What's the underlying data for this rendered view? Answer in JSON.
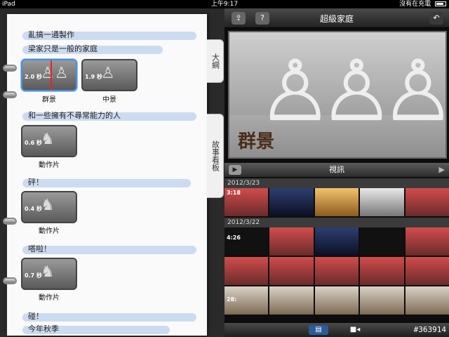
{
  "status": {
    "device": "iPad",
    "time": "上午9:17",
    "charging": "沒有在充電"
  },
  "notebook": {
    "tabs": [
      "大綱",
      "故事看板"
    ],
    "sections": [
      {
        "text": "亂搞一通製作"
      },
      {
        "text": "梁家只是一般的家庭"
      },
      {
        "text": "和一些擁有不尋常能力的人"
      },
      {
        "text": "砰！"
      },
      {
        "text": "嗒啦！"
      },
      {
        "text": "碰！"
      },
      {
        "text": "今年秋季"
      }
    ],
    "clips": [
      {
        "duration": "2.0 秒",
        "label": "群景"
      },
      {
        "duration": "1.9 秒",
        "label": "中景"
      },
      {
        "duration": "0.6 秒",
        "label": "動作片"
      },
      {
        "duration": "0.4 秒",
        "label": "動作片"
      },
      {
        "duration": "0.7 秒",
        "label": "動作片"
      }
    ]
  },
  "viewer": {
    "title": "超級家庭",
    "preview_label": "群景",
    "video_tab": "視訊",
    "dates": [
      "2012/3/23",
      "2012/3/22"
    ],
    "thumb_durations": [
      "3:18",
      "4:26",
      "28:"
    ],
    "watermark": "#363914"
  },
  "colors": {
    "accent": "#4a8ee0",
    "highlight": "#a3bfe6"
  }
}
